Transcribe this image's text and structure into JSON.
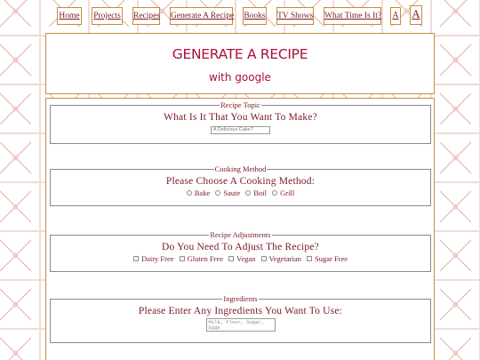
{
  "nav": {
    "items": [
      {
        "label": "Home"
      },
      {
        "label": "Projects"
      },
      {
        "label": "Recipes"
      },
      {
        "label": "Generate A Recipe"
      },
      {
        "label": "Books"
      },
      {
        "label": "TV Shows"
      },
      {
        "label": "What Time Is It?"
      },
      {
        "label": "A"
      },
      {
        "label": "A"
      }
    ]
  },
  "header": {
    "title": "GENERATE A RECIPE",
    "subtitle": "with google"
  },
  "sections": {
    "topic": {
      "legend": "Recipe Topic",
      "question": "What Is It That You Want To Make?",
      "placeholder": "A Delicious Cake?"
    },
    "method": {
      "legend": "Cooking Method",
      "question": "Please Choose A Cooking Method:",
      "options": [
        "Bake",
        "Saute",
        "Boil",
        "Grill"
      ]
    },
    "adjustments": {
      "legend": "Recipe Adjustments",
      "question": "Do You Need To Adjust The Recipe?",
      "options": [
        "Dairy Free",
        "Gluten Free",
        "Vegan",
        "Vegetarian",
        "Sugar Free"
      ]
    },
    "ingredients": {
      "legend": "Ingredients",
      "question": "Please Enter Any Ingredients You Want To Use:",
      "placeholder": "Milk, Flour, Sugar, Eggs"
    }
  },
  "colors": {
    "accent": "#a8123a",
    "text": "#7a1a22",
    "border": "#c98a3e",
    "pattern": "#e8b5b0"
  }
}
